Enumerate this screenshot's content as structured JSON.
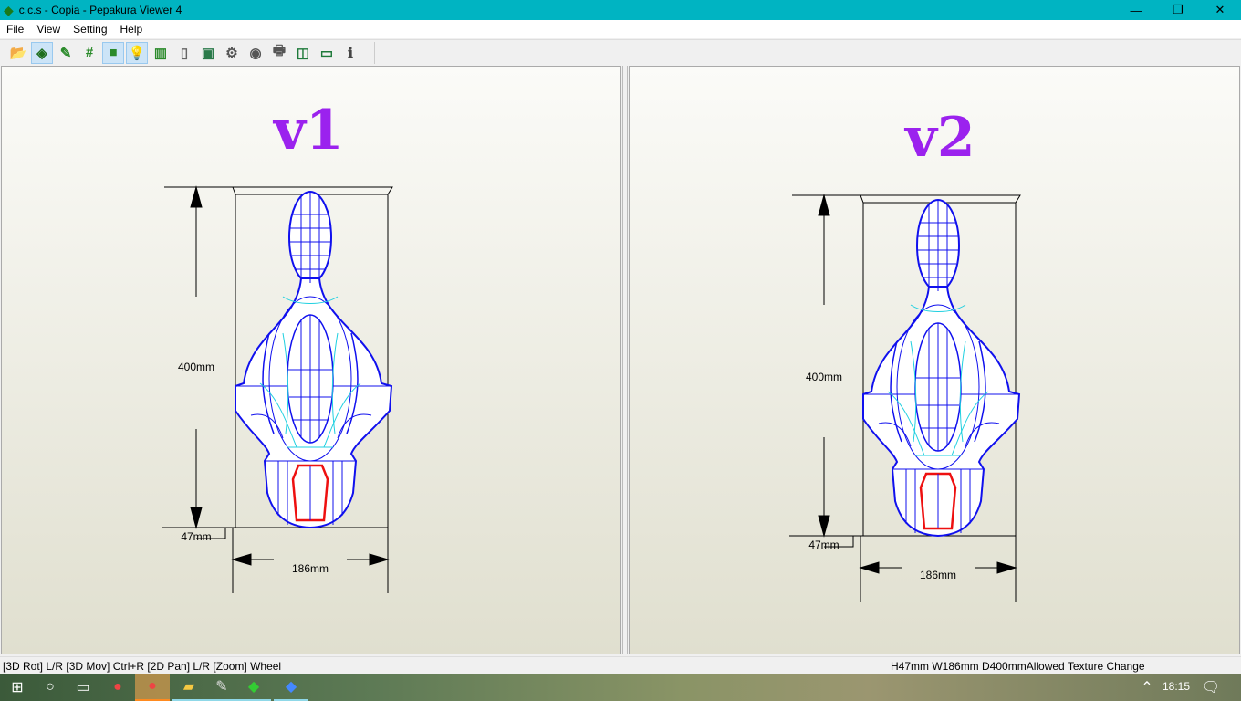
{
  "window": {
    "title": "c.c.s - Copia - Pepakura Viewer 4",
    "minimize": "—",
    "maximize": "❐",
    "close": "✕"
  },
  "menu": [
    "File",
    "View",
    "Setting",
    "Help"
  ],
  "toolbar": [
    {
      "name": "open-icon",
      "glyph": "📂",
      "color": "#2a8a2a",
      "active": false
    },
    {
      "name": "3d-view-icon",
      "glyph": "◈",
      "color": "#1e6e1e",
      "active": true
    },
    {
      "name": "edit-line-icon",
      "glyph": "✎",
      "color": "#2a8a2a",
      "active": false
    },
    {
      "name": "number-icon",
      "glyph": "#",
      "color": "#2a8a2a",
      "active": false
    },
    {
      "name": "cube-icon",
      "glyph": "■",
      "color": "#2a8a2a",
      "active": true
    },
    {
      "name": "light-bulb-icon",
      "glyph": "💡",
      "color": "#e8e060",
      "active": true
    },
    {
      "name": "map-icon",
      "glyph": "▥",
      "color": "#2a8a2a",
      "active": false
    },
    {
      "name": "page-number-icon",
      "glyph": "▯",
      "color": "#666",
      "active": false
    },
    {
      "name": "fit-view-icon",
      "glyph": "▣",
      "color": "#2a7a4a",
      "active": false
    },
    {
      "name": "settings-gear-icon",
      "glyph": "⚙",
      "color": "#555",
      "active": false
    },
    {
      "name": "view-rotate-icon",
      "glyph": "◉",
      "color": "#555",
      "active": false
    },
    {
      "name": "print-icon",
      "glyph": "🖶",
      "color": "#555",
      "active": false
    },
    {
      "name": "split-view-icon",
      "glyph": "◫",
      "color": "#1e7a3a",
      "active": false
    },
    {
      "name": "single-view-icon",
      "glyph": "▭",
      "color": "#1e7a3a",
      "active": false
    },
    {
      "name": "info-icon",
      "glyph": "ℹ",
      "color": "#444",
      "active": false
    }
  ],
  "views": [
    {
      "label": "v1",
      "height": "400mm",
      "depth": "47mm",
      "width": "186mm"
    },
    {
      "label": "v2",
      "height": "400mm",
      "depth": "47mm",
      "width": "186mm"
    }
  ],
  "colors": {
    "label": "#9b22ee",
    "wire": "#1010ee",
    "seam": "#20d0e0",
    "cut": "#ee1010"
  },
  "status": {
    "left": "[3D Rot] L/R [3D Mov] Ctrl+R [2D Pan] L/R [Zoom] Wheel",
    "right": "H47mm W186mm D400mmAllowed Texture Change"
  },
  "taskbar": {
    "time": "18:15"
  }
}
